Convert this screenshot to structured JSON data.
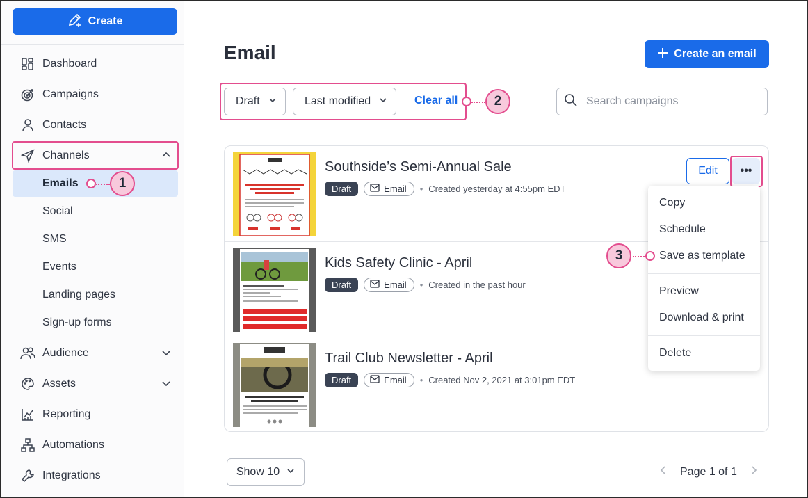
{
  "sidebar": {
    "create_label": "Create",
    "nav": [
      {
        "label": "Dashboard",
        "icon": "dashboard-icon"
      },
      {
        "label": "Campaigns",
        "icon": "target-icon"
      },
      {
        "label": "Contacts",
        "icon": "person-icon"
      },
      {
        "label": "Channels",
        "icon": "paper-plane-icon"
      }
    ],
    "channels_sub": [
      "Emails",
      "Social",
      "SMS",
      "Events",
      "Landing pages",
      "Sign-up forms"
    ],
    "nav2": [
      {
        "label": "Audience",
        "icon": "people-icon"
      },
      {
        "label": "Assets",
        "icon": "palette-icon"
      },
      {
        "label": "Reporting",
        "icon": "chart-icon"
      },
      {
        "label": "Automations",
        "icon": "flow-icon"
      },
      {
        "label": "Integrations",
        "icon": "wrench-icon"
      }
    ]
  },
  "header": {
    "title": "Email",
    "create_email_label": "Create an email"
  },
  "filters": {
    "status": "Draft",
    "sort": "Last modified",
    "clear_all": "Clear all"
  },
  "search": {
    "placeholder": "Search campaigns"
  },
  "emails": [
    {
      "title": "Southside’s Semi-Annual Sale",
      "status": "Draft",
      "type": "Email",
      "created": "Created yesterday at 4:55pm EDT"
    },
    {
      "title": "Kids Safety Clinic - April",
      "status": "Draft",
      "type": "Email",
      "created": "Created in the past hour"
    },
    {
      "title": "Trail Club Newsletter - April",
      "status": "Draft",
      "type": "Email",
      "created": "Created Nov 2, 2021 at 3:01pm EDT"
    }
  ],
  "row_actions": {
    "edit": "Edit",
    "more": "•••"
  },
  "menu": {
    "items": [
      "Copy",
      "Schedule",
      "Save as template",
      "Preview",
      "Download & print",
      "Delete"
    ]
  },
  "callouts": [
    "1",
    "2",
    "3"
  ],
  "footer": {
    "show_label": "Show 10",
    "page_label": "Page 1 of 1"
  },
  "colors": {
    "accent": "#1a6be9",
    "callout": "#e34d8e",
    "callout_fill": "#f8c9dc",
    "active_nav": "#dbe8fb"
  }
}
